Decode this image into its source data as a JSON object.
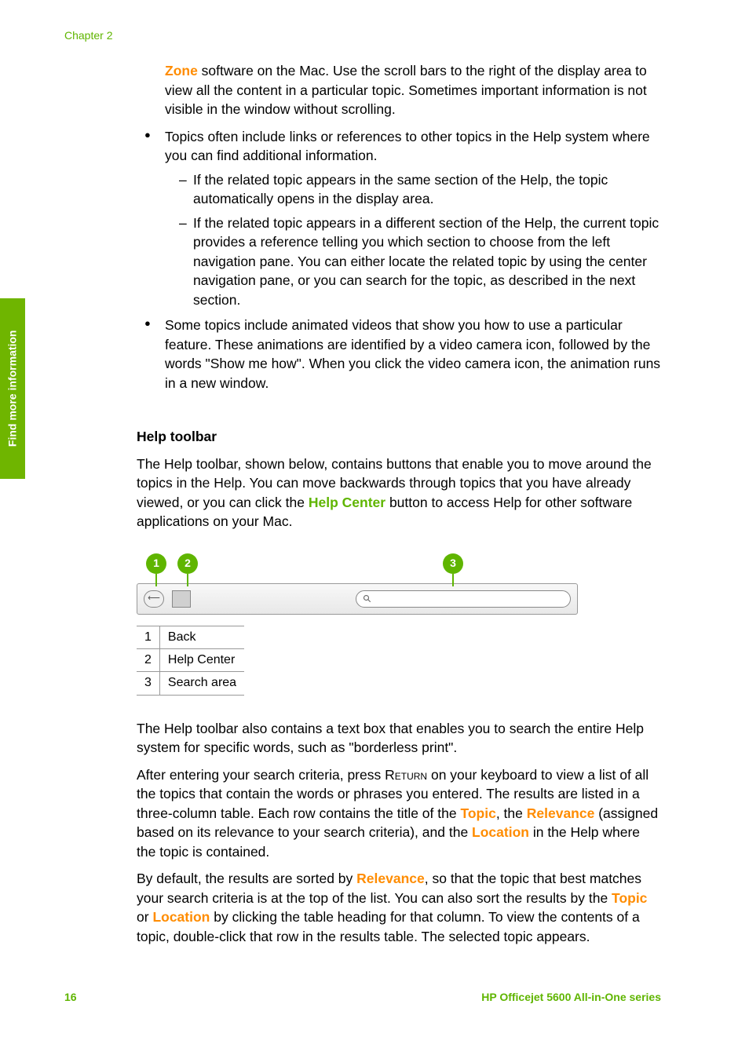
{
  "chapter": "Chapter 2",
  "side_tab": "Find more information",
  "intro": {
    "zone": "Zone",
    "zone_after": " software on the Mac. Use the scroll bars to the right of the display area to view all the content in a particular topic. Sometimes important information is not visible in the window without scrolling."
  },
  "bullets": {
    "b1": "Topics often include links or references to other topics in the Help system where you can find additional information.",
    "sub1": "If the related topic appears in the same section of the Help, the topic automatically opens in the display area.",
    "sub2": "If the related topic appears in a different section of the Help, the current topic provides a reference telling you which section to choose from the left navigation pane. You can either locate the related topic by using the center navigation pane, or you can search for the topic, as described in the next section.",
    "b2": "Some topics include animated videos that show you how to use a particular feature. These animations are identified by a video camera icon, followed by the words \"Show me how\". When you click the video camera icon, the animation runs in a new window."
  },
  "heading": "Help toolbar",
  "toolbar_para": {
    "before": "The Help toolbar, shown below, contains buttons that enable you to move around the topics in the Help. You can move backwards through topics that you have already viewed, or you can click the ",
    "help_center": "Help Center",
    "after": " button to access Help for other software applications on your Mac."
  },
  "callouts": {
    "c1": "1",
    "c2": "2",
    "c3": "3"
  },
  "legend": {
    "rows": [
      {
        "num": "1",
        "label": "Back"
      },
      {
        "num": "2",
        "label": "Help Center"
      },
      {
        "num": "3",
        "label": "Search area"
      }
    ]
  },
  "after": {
    "p1": "The Help toolbar also contains a text box that enables you to search the entire Help system for specific words, such as \"borderless print\".",
    "p2_before": "After entering your search criteria, press ",
    "return": "Return",
    "p2_mid": " on your keyboard to view a list of all the topics that contain the words or phrases you entered. The results are listed in a three-column table. Each row contains the title of the ",
    "topic": "Topic",
    "p2_mid2": ", the ",
    "relevance": "Relevance",
    "p2_mid3": " (assigned based on its relevance to your search criteria), and the ",
    "location": "Location",
    "p2_after": " in the Help where the topic is contained.",
    "p3_before": "By default, the results are sorted by ",
    "p3_mid1": ", so that the topic that best matches your search criteria is at the top of the list. You can also sort the results by the ",
    "p3_mid2": " or ",
    "p3_after": " by clicking the table heading for that column. To view the contents of a topic, double-click that row in the results table. The selected topic appears."
  },
  "footer": {
    "page": "16",
    "product": "HP Officejet 5600 All-in-One series"
  }
}
